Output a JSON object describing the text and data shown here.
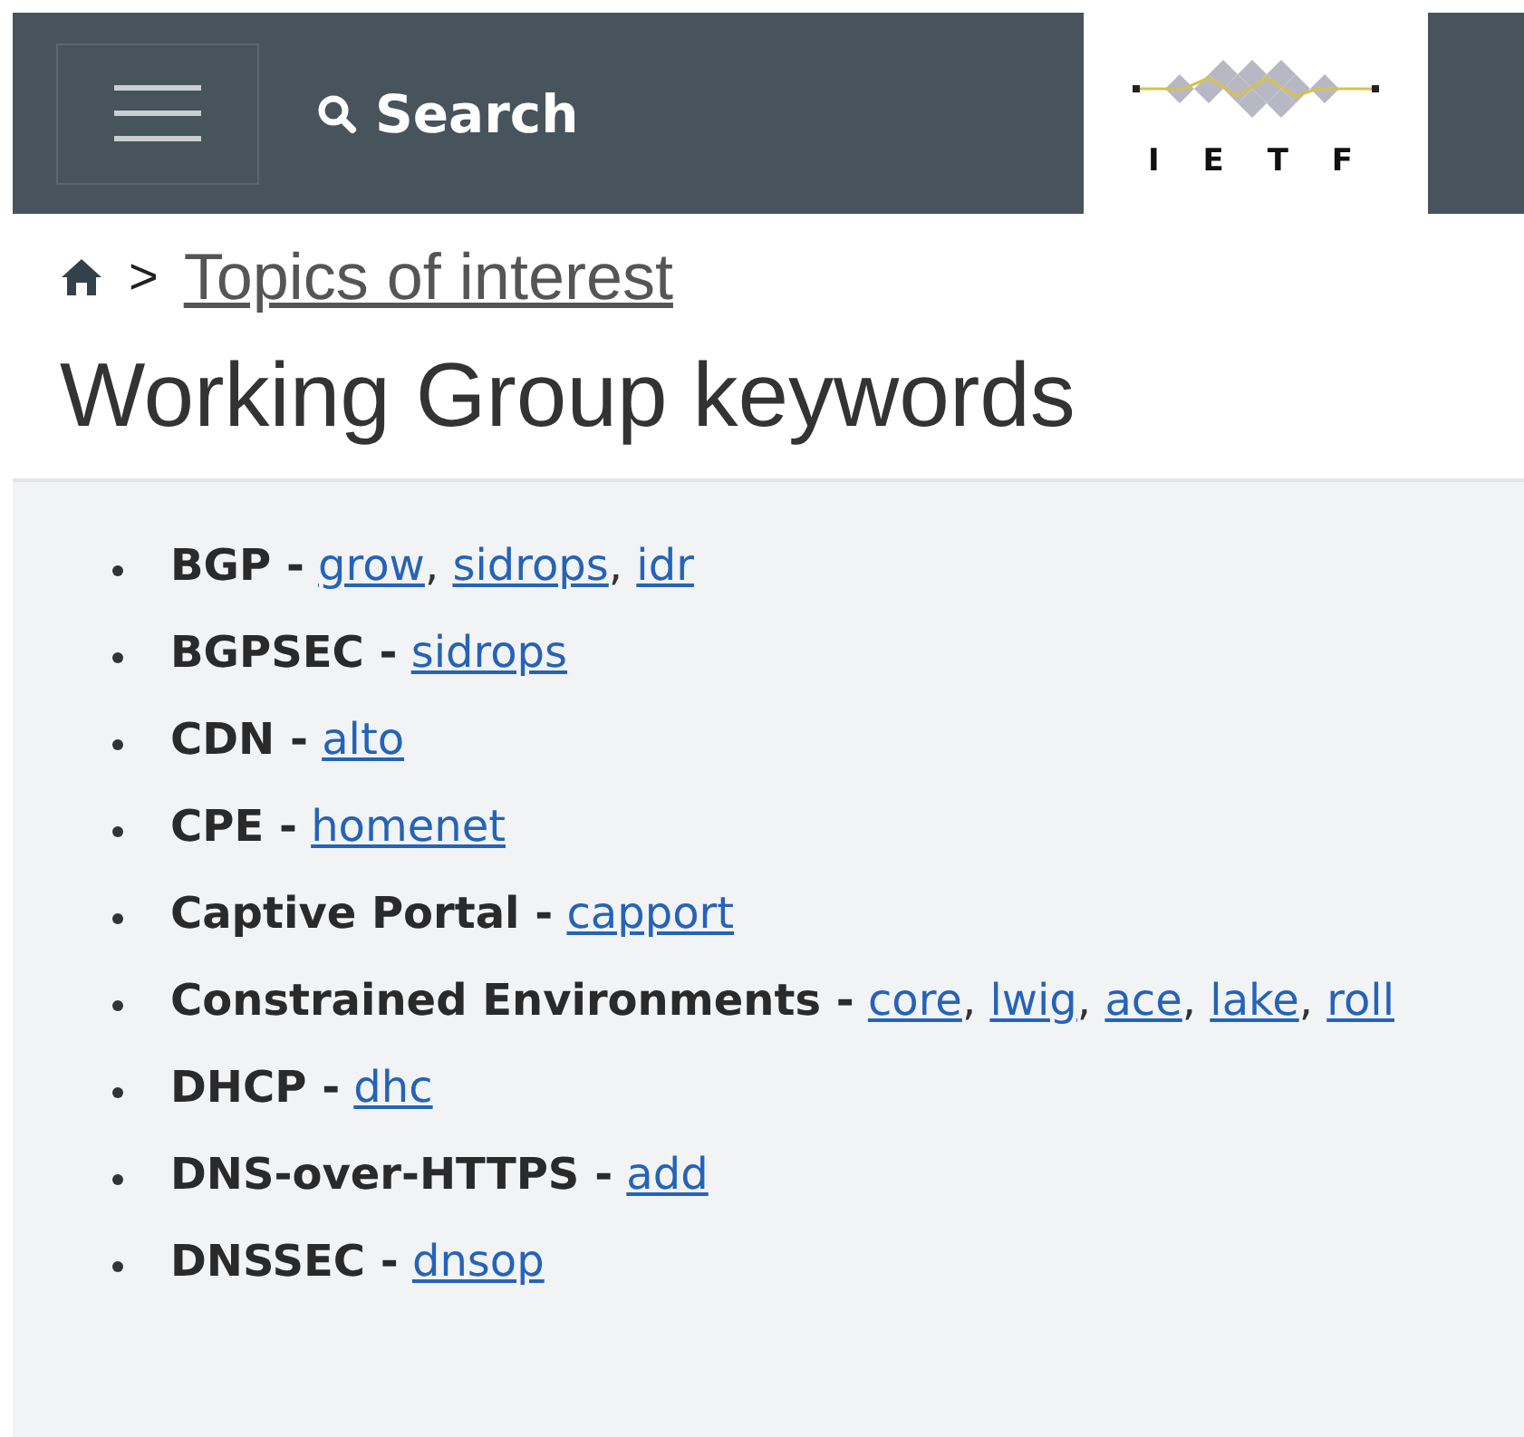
{
  "header": {
    "search_label": "Search",
    "logo_text": "I E T F"
  },
  "breadcrumb": {
    "separator": ">",
    "link": "Topics of interest"
  },
  "title": "Working Group keywords",
  "keywords": [
    {
      "term": "BGP -",
      "links": [
        {
          "label": "grow",
          "after": ","
        },
        {
          "label": "sidrops",
          "after": ","
        },
        {
          "label": "idr"
        }
      ]
    },
    {
      "term": "BGPSEC -",
      "links": [
        {
          "label": "sidrops"
        }
      ]
    },
    {
      "term": "CDN -",
      "links": [
        {
          "label": "alto"
        }
      ]
    },
    {
      "term": "CPE -",
      "links": [
        {
          "label": "homenet"
        }
      ]
    },
    {
      "term": "Captive Portal -",
      "links": [
        {
          "label": "capport"
        }
      ]
    },
    {
      "term": "Constrained Environments -",
      "links": [
        {
          "label": "core",
          "after": ","
        },
        {
          "label": "lwig",
          "after": ","
        },
        {
          "label": "ace",
          "after": ","
        },
        {
          "label": "lake",
          "after": ","
        },
        {
          "label": "roll"
        }
      ]
    },
    {
      "term": "DHCP -",
      "links": [
        {
          "label": "dhc"
        }
      ]
    },
    {
      "term": "DNS-over-HTTPS -",
      "links": [
        {
          "label": "add"
        }
      ]
    },
    {
      "term": "DNSSEC -",
      "links": [
        {
          "label": "dnsop"
        }
      ]
    }
  ]
}
